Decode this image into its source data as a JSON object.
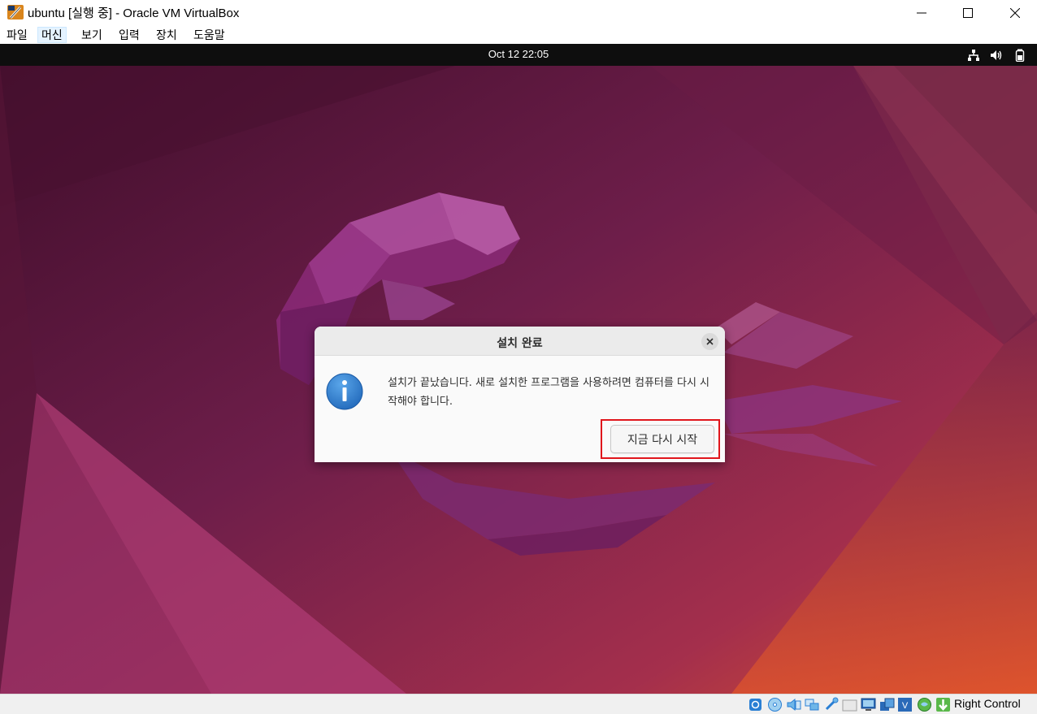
{
  "window": {
    "title": "ubuntu [실행 중] - Oracle VM VirtualBox",
    "app_icon": "virtualbox-icon",
    "controls": [
      "minimize-icon",
      "maximize-icon",
      "close-icon"
    ]
  },
  "menu": {
    "items": [
      {
        "label": "파일"
      },
      {
        "label": "머신",
        "active": true
      },
      {
        "label": "보기"
      },
      {
        "label": "입력"
      },
      {
        "label": "장치"
      },
      {
        "label": "도움말"
      }
    ]
  },
  "guest": {
    "topbar": {
      "clock": "Oct 12  22:05",
      "tray": [
        "network-icon",
        "volume-icon",
        "battery-icon"
      ]
    },
    "wallpaper": "ubuntu-jammy-jellyfish-wallpaper"
  },
  "dialog": {
    "title": "설치 완료",
    "icon": "info-icon",
    "message": "설치가 끝났습니다. 새로 설치한 프로그램을 사용하려면 컴퓨터를 다시 시작해야 합니다.",
    "button_label": "지금 다시 시작",
    "highlight_color": "#e0161c"
  },
  "statusbar": {
    "icons": [
      "hard-disk-icon",
      "optical-drive-icon",
      "audio-icon",
      "network-adapter-icon",
      "usb-icon",
      "shared-folders-icon",
      "display-icon",
      "recording-icon",
      "vt-x-icon",
      "guest-additions-icon",
      "mouse-integration-icon"
    ],
    "host_key": "Right Control"
  },
  "colors": {
    "guest_topbar": "#0e0e0e",
    "dialog_bg": "#fafafa",
    "info_blue": "#2a7fd4"
  }
}
